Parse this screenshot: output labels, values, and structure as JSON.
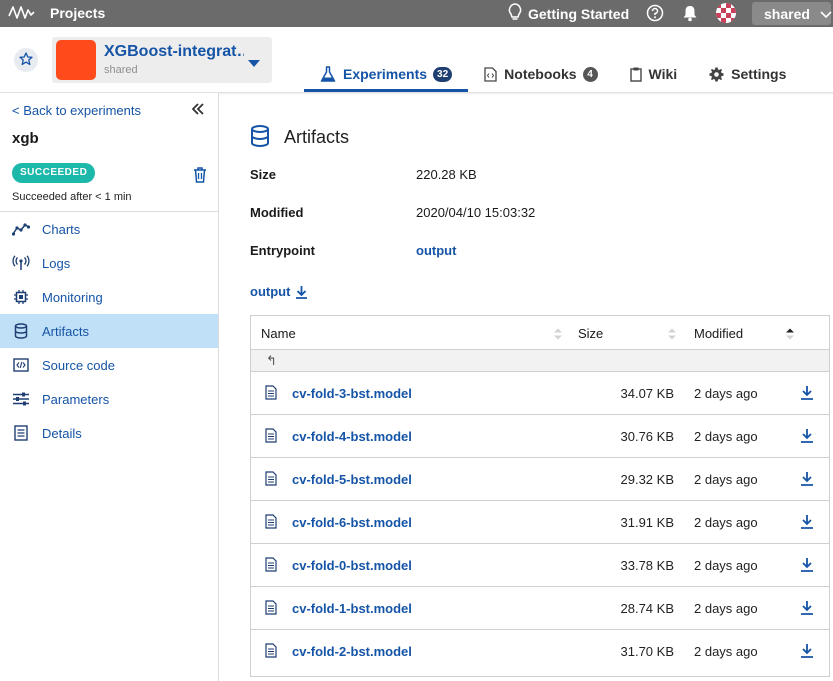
{
  "topbar": {
    "projects_label": "Projects",
    "getting_started_label": "Getting Started",
    "account_label": "shared",
    "bg_color": "#6b6b6b"
  },
  "project": {
    "name": "XGBoost-integrat…",
    "owner": "shared",
    "color": "#ff4a1c"
  },
  "tabs": [
    {
      "label": "Experiments",
      "badge": "32",
      "icon": "flask-icon",
      "active": true
    },
    {
      "label": "Notebooks",
      "badge": "4",
      "icon": "notebook-icon",
      "active": false
    },
    {
      "label": "Wiki",
      "icon": "clipboard-icon",
      "active": false
    },
    {
      "label": "Settings",
      "icon": "gear-icon",
      "active": false
    }
  ],
  "sidebar": {
    "back_label": "< Back to experiments",
    "experiment_name": "xgb",
    "status": "SUCCEEDED",
    "status_text": "Succeeded after < 1 min",
    "items": [
      {
        "label": "Charts",
        "icon": "chart-line-icon"
      },
      {
        "label": "Logs",
        "icon": "broadcast-icon"
      },
      {
        "label": "Monitoring",
        "icon": "cpu-icon"
      },
      {
        "label": "Artifacts",
        "icon": "database-icon",
        "active": true
      },
      {
        "label": "Source code",
        "icon": "code-file-icon"
      },
      {
        "label": "Parameters",
        "icon": "sliders-icon"
      },
      {
        "label": "Details",
        "icon": "details-icon"
      }
    ]
  },
  "artifacts": {
    "title": "Artifacts",
    "size_label": "Size",
    "size_value": "220.28 KB",
    "modified_label": "Modified",
    "modified_value": "2020/04/10 15:03:32",
    "entrypoint_label": "Entrypoint",
    "entrypoint_value": "output",
    "path_link": "output",
    "table": {
      "headers": {
        "name": "Name",
        "size": "Size",
        "modified": "Modified"
      },
      "up_symbol": "↰",
      "rows": [
        {
          "name": "cv-fold-3-bst.model",
          "size": "34.07 KB",
          "modified": "2 days ago"
        },
        {
          "name": "cv-fold-4-bst.model",
          "size": "30.76 KB",
          "modified": "2 days ago"
        },
        {
          "name": "cv-fold-5-bst.model",
          "size": "29.32 KB",
          "modified": "2 days ago"
        },
        {
          "name": "cv-fold-6-bst.model",
          "size": "31.91 KB",
          "modified": "2 days ago"
        },
        {
          "name": "cv-fold-0-bst.model",
          "size": "33.78 KB",
          "modified": "2 days ago"
        },
        {
          "name": "cv-fold-1-bst.model",
          "size": "28.74 KB",
          "modified": "2 days ago"
        },
        {
          "name": "cv-fold-2-bst.model",
          "size": "31.70 KB",
          "modified": "2 days ago"
        }
      ]
    }
  },
  "colors": {
    "link": "#1554a6",
    "active_nav_bg": "#bfe0f7",
    "status_badge": "#1cb8aa"
  }
}
